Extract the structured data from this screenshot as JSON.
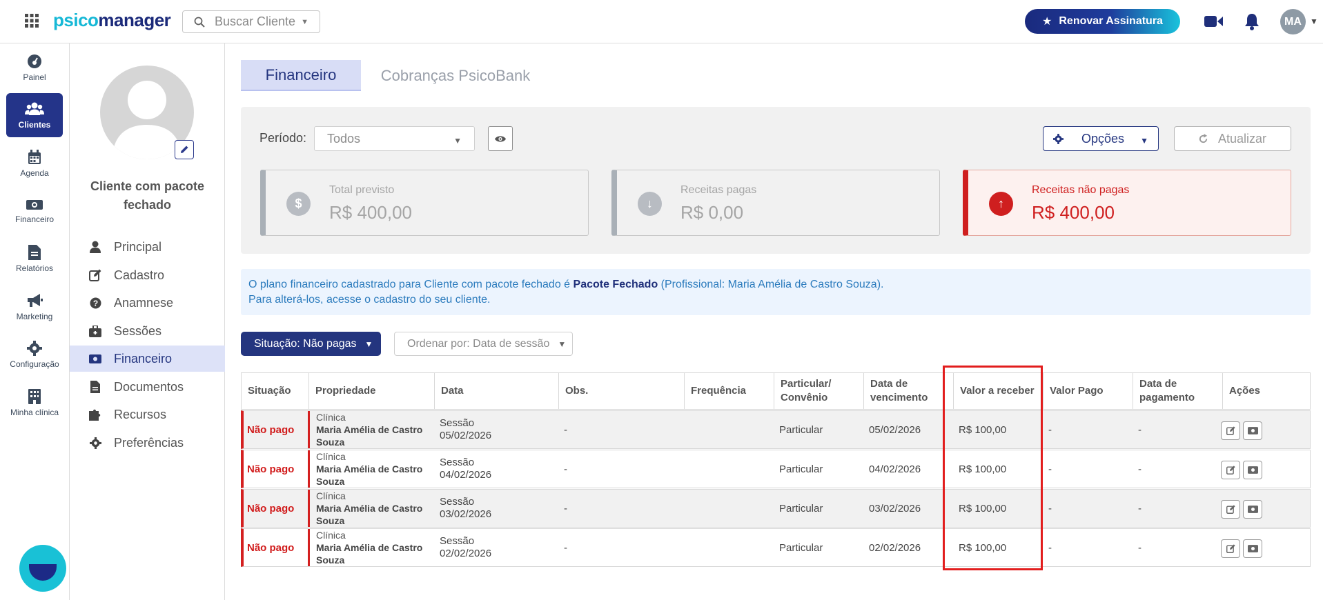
{
  "colors": {
    "brand_dark": "#24357f",
    "brand_cyan": "#16b8d6",
    "danger": "#d42020",
    "highlight": "#e21d1d"
  },
  "topbar": {
    "logo_part1": "psico",
    "logo_part2": "manager",
    "search_placeholder": "Buscar Cliente",
    "renew_label": "Renovar Assinatura",
    "avatar_initials": "MA"
  },
  "leftnav": [
    {
      "label": "Painel",
      "icon": "dashboard-icon"
    },
    {
      "label": "Clientes",
      "icon": "users-icon"
    },
    {
      "label": "Agenda",
      "icon": "calendar-icon"
    },
    {
      "label": "Financeiro",
      "icon": "money-icon"
    },
    {
      "label": "Relatórios",
      "icon": "report-icon"
    },
    {
      "label": "Marketing",
      "icon": "megaphone-icon"
    },
    {
      "label": "Configuração",
      "icon": "gear-icon"
    },
    {
      "label": "Minha clínica",
      "icon": "building-icon"
    }
  ],
  "client": {
    "name": "Cliente com pacote fechado",
    "menu": [
      {
        "label": "Principal",
        "icon": "person-icon"
      },
      {
        "label": "Cadastro",
        "icon": "edit-icon"
      },
      {
        "label": "Anamnese",
        "icon": "question-icon"
      },
      {
        "label": "Sessões",
        "icon": "briefcase-icon"
      },
      {
        "label": "Financeiro",
        "icon": "money-icon"
      },
      {
        "label": "Documentos",
        "icon": "document-icon"
      },
      {
        "label": "Recursos",
        "icon": "puzzle-icon"
      },
      {
        "label": "Preferências",
        "icon": "gear-icon"
      }
    ]
  },
  "tabs": {
    "active": "Financeiro",
    "inactive": "Cobranças PsicoBank"
  },
  "filters": {
    "periodo_label": "Período:",
    "periodo_value": "Todos",
    "opcoes_label": "Opções",
    "atualizar_label": "Atualizar"
  },
  "summary": {
    "total": {
      "title": "Total previsto",
      "value": "R$ 400,00"
    },
    "pagas": {
      "title": "Receitas pagas",
      "value": "R$ 0,00"
    },
    "nao_pagas": {
      "title": "Receitas não pagas",
      "value": "R$ 400,00"
    }
  },
  "info": {
    "line1_pre": "O plano financeiro cadastrado para Cliente com pacote fechado é ",
    "line1_bold": "Pacote Fechado",
    "line1_post": " (Profissional: Maria Amélia de Castro Souza).",
    "line2": "Para alterá-los, acesse o cadastro do seu cliente."
  },
  "list_filters": {
    "situacao": "Situação: Não pagas",
    "ordenar": "Ordenar por: Data de sessão"
  },
  "table": {
    "headers": {
      "situacao": "Situação",
      "propriedade": "Propriedade",
      "data": "Data",
      "obs": "Obs.",
      "frequencia": "Frequência",
      "particular_l1": "Particular/",
      "particular_l2": "Convênio",
      "vencimento_l1": "Data de",
      "vencimento_l2": "vencimento",
      "valor_receber": "Valor a receber",
      "valor_pago": "Valor Pago",
      "pagamento_l1": "Data de",
      "pagamento_l2": "pagamento",
      "acoes": "Ações"
    },
    "rows": [
      {
        "status": "Não pago",
        "prop1": "Clínica",
        "prop2": "Maria Amélia de Castro",
        "prop3": "Souza",
        "data1": "Sessão",
        "data2": "05/02/2026",
        "obs": "-",
        "freq": "",
        "tipo": "Particular",
        "venc": "05/02/2026",
        "valor": "R$ 100,00",
        "pago": "-",
        "pagamento": "-"
      },
      {
        "status": "Não pago",
        "prop1": "Clínica",
        "prop2": "Maria Amélia de Castro",
        "prop3": "Souza",
        "data1": "Sessão",
        "data2": "04/02/2026",
        "obs": "-",
        "freq": "",
        "tipo": "Particular",
        "venc": "04/02/2026",
        "valor": "R$ 100,00",
        "pago": "-",
        "pagamento": "-"
      },
      {
        "status": "Não pago",
        "prop1": "Clínica",
        "prop2": "Maria Amélia de Castro",
        "prop3": "Souza",
        "data1": "Sessão",
        "data2": "03/02/2026",
        "obs": "-",
        "freq": "",
        "tipo": "Particular",
        "venc": "03/02/2026",
        "valor": "R$ 100,00",
        "pago": "-",
        "pagamento": "-"
      },
      {
        "status": "Não pago",
        "prop1": "Clínica",
        "prop2": "Maria Amélia de Castro",
        "prop3": "Souza",
        "data1": "Sessão",
        "data2": "02/02/2026",
        "obs": "-",
        "freq": "",
        "tipo": "Particular",
        "venc": "02/02/2026",
        "valor": "R$ 100,00",
        "pago": "-",
        "pagamento": "-"
      }
    ]
  }
}
